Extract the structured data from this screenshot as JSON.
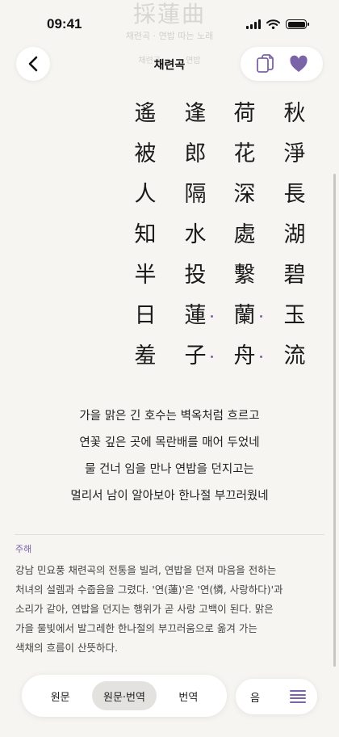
{
  "status": {
    "time": "09:41"
  },
  "background_header": {
    "title": "採蓮曲",
    "meta": "채련곡 · 연밥 따는 노래",
    "tags": [
      "채련곡",
      "연밥"
    ]
  },
  "nav": {
    "title": "채련곡"
  },
  "poem": {
    "columns": [
      [
        "秋",
        "淨",
        "長",
        "湖",
        "碧",
        "玉",
        "流"
      ],
      [
        "荷",
        "花",
        "深",
        "處",
        "繫",
        "蘭",
        "舟"
      ],
      [
        "逢",
        "郎",
        "隔",
        "水",
        "投",
        "蓮",
        "子"
      ],
      [
        "遙",
        "被",
        "人",
        "知",
        "半",
        "日",
        "羞"
      ]
    ]
  },
  "translation": [
    "가을 맑은 긴 호수는 벽옥처럼 흐르고",
    "연꽃 깊은 곳에 목란배를 매어 두었네",
    "물 건너 임을 만나 연밥을 던지고는",
    "멀리서 남이 알아보아 한나절 부끄러웠네"
  ],
  "notes": {
    "label": "주해",
    "lines": [
      "강남 민요풍 채련곡의 전통을 빌려, 연밥을 던져 마음을 전하는",
      "처녀의 설렘과 수줍음을 그렸다. '연(蓮)'은 '연(憐, 사랑하다)'과",
      "소리가 같아, 연밥을 던지는 행위가 곧 사랑 고백이 된다. 맑은",
      "가을 물빛에서 발그레한 한나절의 부끄러움으로 옮겨 가는",
      "색채의 흐름이 산뜻하다."
    ]
  },
  "modes": {
    "original": "원문",
    "both": "원문·번역",
    "translated": "번역",
    "active": "both"
  },
  "audio_label": "음",
  "colors": {
    "accent": "#7b63a8",
    "background": "#f6f5f1"
  }
}
